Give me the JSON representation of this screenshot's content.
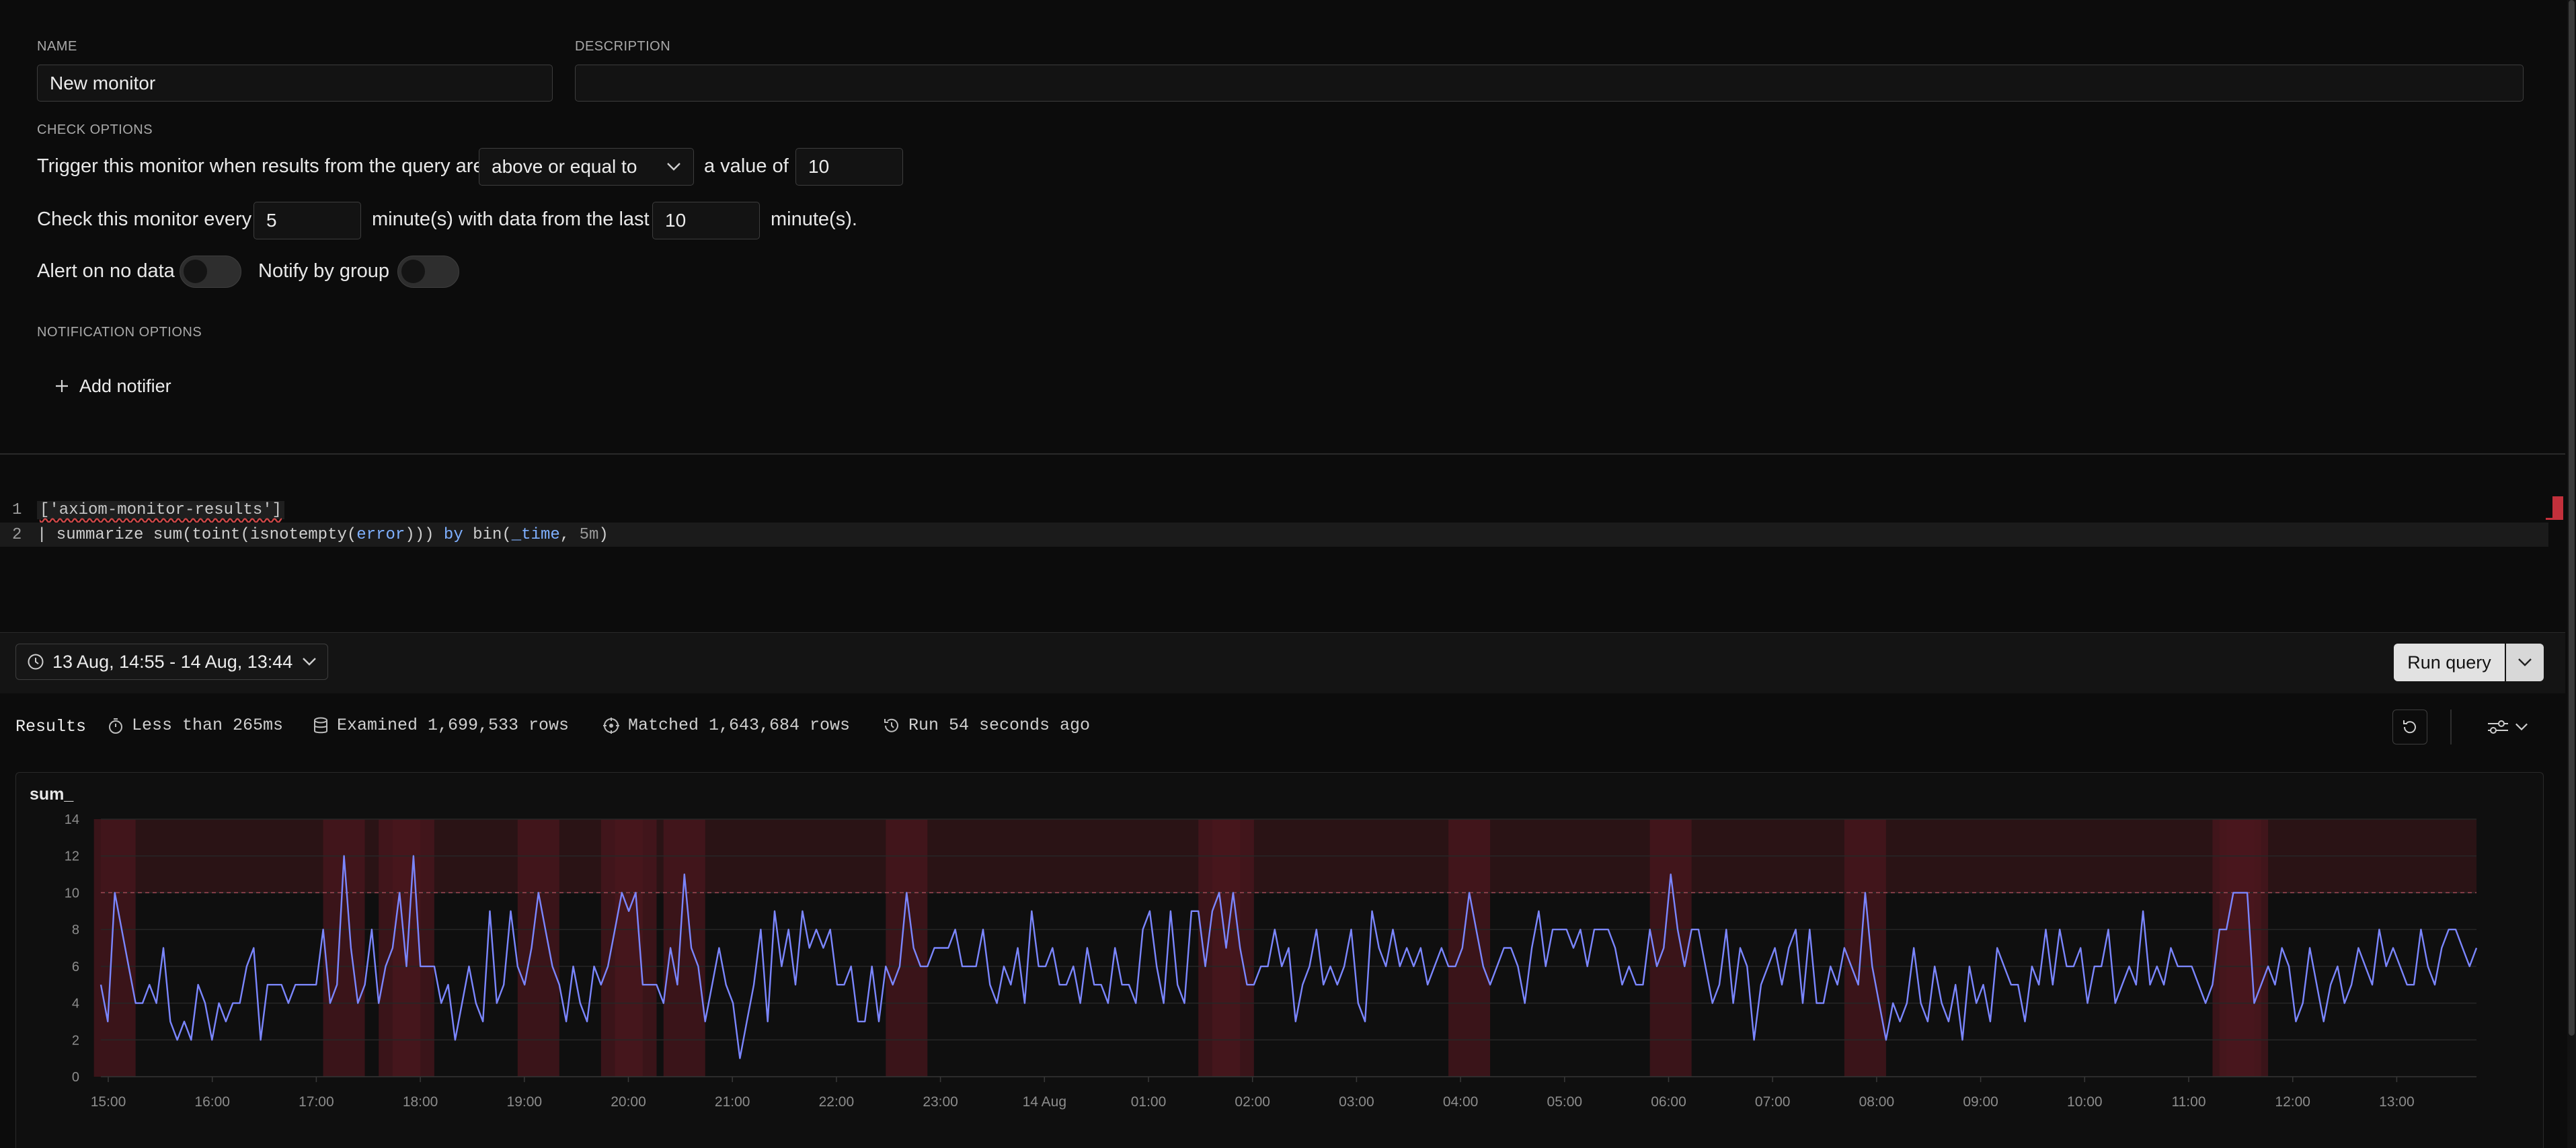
{
  "form": {
    "name_label": "NAME",
    "name_value": "New monitor",
    "description_label": "DESCRIPTION",
    "description_value": "",
    "check_options_label": "CHECK OPTIONS",
    "trigger_prefix": "Trigger this monitor when results from the query are",
    "trigger_operator": "above or equal to",
    "trigger_value_label": "a value of",
    "trigger_value": "10",
    "check_every_label": "Check this monitor every",
    "check_every_value": "5",
    "data_from_last_label": "minute(s) with data from the last",
    "data_from_last_value": "10",
    "minutes_suffix": "minute(s).",
    "alert_no_data_label": "Alert on no data",
    "notify_group_label": "Notify by group",
    "notification_options_label": "NOTIFICATION OPTIONS",
    "add_notifier_label": "Add notifier"
  },
  "editor": {
    "line1_num": "1",
    "line1_code": "['axiom-monitor-results']",
    "line2_num": "2",
    "line2_tokens": [
      "| summarize ",
      "sum(",
      "toint(",
      "isnotempty(",
      "error",
      "))) ",
      "by ",
      "bin(",
      "_time",
      ", ",
      "5m",
      ")"
    ]
  },
  "toolbar": {
    "time_range": "13 Aug, 14:55 - 14 Aug, 13:44",
    "run_query_label": "Run query"
  },
  "results": {
    "title": "Results",
    "duration": "Less than 265ms",
    "examined": "Examined 1,699,533 rows",
    "matched": "Matched 1,643,684 rows",
    "run_ago": "Run 54 seconds ago"
  },
  "icons": [
    "clock-icon",
    "chevron-down-icon",
    "plus-icon",
    "stopwatch-icon",
    "database-icon",
    "target-icon",
    "history-icon",
    "refresh-icon",
    "sliders-icon"
  ],
  "colors": {
    "line": "#7b86ff",
    "alert_band": "#5a1d24",
    "threshold": "#a04a55"
  },
  "chart_data": {
    "type": "line",
    "title": "sum_",
    "ylim": [
      0,
      14
    ],
    "y_ticks": [
      "0",
      "2",
      "4",
      "6",
      "8",
      "10",
      "12",
      "14"
    ],
    "x_ticks": [
      "15:00",
      "16:00",
      "17:00",
      "18:00",
      "19:00",
      "20:00",
      "21:00",
      "22:00",
      "23:00",
      "14 Aug",
      "01:00",
      "02:00",
      "03:00",
      "04:00",
      "05:00",
      "06:00",
      "07:00",
      "08:00",
      "09:00",
      "10:00",
      "11:00",
      "12:00",
      "13:00"
    ],
    "threshold": 10,
    "grid": true,
    "series": [
      {
        "values": [
          5,
          3,
          10,
          8,
          6,
          4,
          4,
          5,
          4,
          7,
          3,
          2,
          3,
          2,
          5,
          4,
          2,
          4,
          3,
          4,
          4,
          6,
          7,
          2,
          5,
          5,
          5,
          4,
          5,
          5,
          5,
          5,
          8,
          4,
          5,
          12,
          7,
          4,
          5,
          8,
          4,
          6,
          7,
          10,
          6,
          12,
          6,
          6,
          6,
          4,
          5,
          2,
          4,
          6,
          4,
          3,
          9,
          4,
          5,
          9,
          6,
          5,
          7,
          10,
          8,
          6,
          5,
          3,
          6,
          4,
          3,
          6,
          5,
          6,
          8,
          10,
          9,
          10,
          5,
          5,
          5,
          4,
          7,
          5,
          11,
          7,
          6,
          3,
          5,
          7,
          5,
          4,
          1,
          3,
          5,
          8,
          3,
          9,
          6,
          8,
          5,
          9,
          7,
          8,
          7,
          8,
          5,
          5,
          6,
          3,
          3,
          6,
          3,
          6,
          5,
          6,
          10,
          7,
          6,
          6,
          7,
          7,
          7,
          8,
          6,
          6,
          6,
          8,
          5,
          4,
          6,
          5,
          7,
          4,
          9,
          6,
          6,
          7,
          5,
          5,
          6,
          4,
          7,
          5,
          5,
          4,
          7,
          5,
          5,
          4,
          8,
          9,
          6,
          4,
          9,
          5,
          4,
          9,
          9,
          6,
          9,
          10,
          7,
          10,
          7,
          5,
          5,
          6,
          6,
          8,
          6,
          7,
          3,
          5,
          6,
          8,
          5,
          6,
          5,
          6,
          8,
          4,
          3,
          9,
          7,
          6,
          8,
          6,
          7,
          6,
          7,
          5,
          6,
          7,
          6,
          6,
          7,
          10,
          8,
          6,
          5,
          6,
          7,
          7,
          6,
          4,
          7,
          9,
          6,
          8,
          8,
          8,
          7,
          8,
          6,
          8,
          8,
          8,
          7,
          5,
          6,
          5,
          5,
          8,
          6,
          7,
          11,
          8,
          6,
          8,
          8,
          6,
          4,
          5,
          8,
          4,
          7,
          6,
          2,
          5,
          6,
          7,
          5,
          7,
          8,
          4,
          8,
          4,
          4,
          6,
          5,
          7,
          6,
          5,
          10,
          6,
          4,
          2,
          4,
          3,
          4,
          7,
          4,
          3,
          6,
          4,
          3,
          5,
          2,
          6,
          4,
          5,
          3,
          7,
          6,
          5,
          5,
          3,
          6,
          5,
          8,
          5,
          8,
          6,
          6,
          7,
          4,
          6,
          6,
          8,
          4,
          5,
          6,
          5,
          9,
          5,
          6,
          5,
          7,
          6,
          6,
          6,
          5,
          4,
          5,
          8,
          8,
          10,
          10,
          10,
          4,
          5,
          6,
          5,
          7,
          6,
          3,
          4,
          7,
          5,
          3,
          5,
          6,
          4,
          5,
          7,
          6,
          5,
          8,
          6,
          7,
          6,
          5,
          5,
          8,
          6,
          5,
          7,
          8,
          8,
          7,
          6,
          7
        ]
      }
    ]
  }
}
